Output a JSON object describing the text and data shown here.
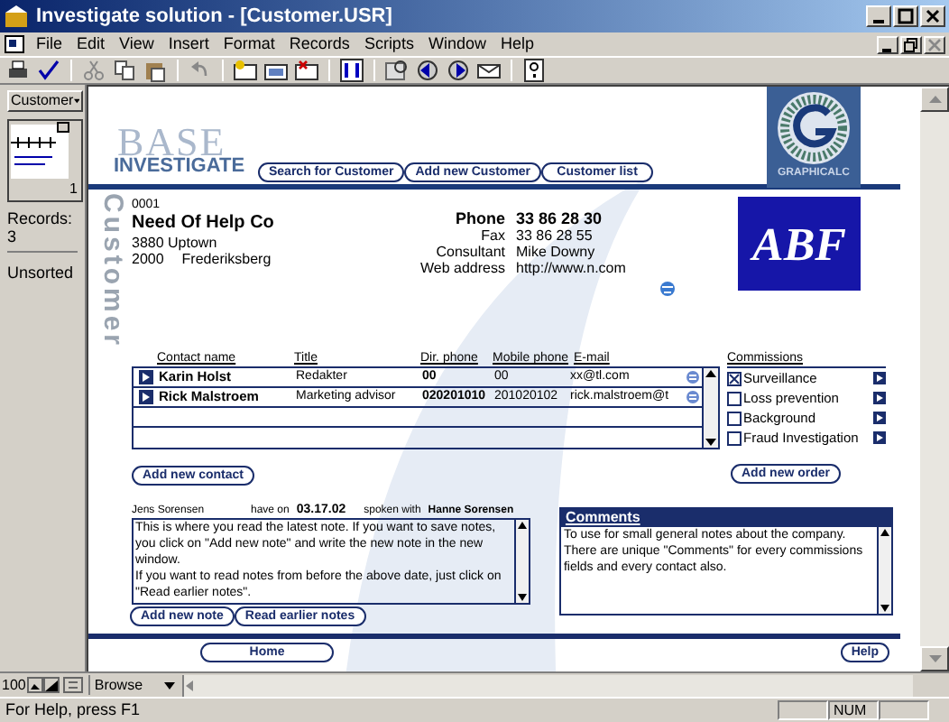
{
  "window": {
    "title": "Investigate solution - [Customer.USR]"
  },
  "menu": [
    "File",
    "Edit",
    "View",
    "Insert",
    "Format",
    "Records",
    "Scripts",
    "Window",
    "Help"
  ],
  "status_area": {
    "layout": "Customer",
    "record_number": "1",
    "records_label": "Records:",
    "records_count": "3",
    "sort_state": "Unsorted"
  },
  "header": {
    "logo_faded": "BASE",
    "logo": "INVESTIGATE",
    "nav_buttons": [
      "Search for Customer",
      "Add new Customer",
      "Customer list"
    ],
    "brand_caption": "GRAPHICALC"
  },
  "section_label": "Customer",
  "customer": {
    "number": "0001",
    "name": "Need Of Help Co",
    "address": "3880 Uptown",
    "postcode": "2000",
    "city": "Frederiksberg",
    "logo_text": "ABF",
    "fields": [
      {
        "label": "Phone",
        "value": "33 86 28 30",
        "bold": true
      },
      {
        "label": "Fax",
        "value": "33 86 28 55",
        "bold": false
      },
      {
        "label": "Consultant",
        "value": "Mike Downy",
        "bold": false
      },
      {
        "label": "Web address",
        "value": "http://www.n.com",
        "bold": false
      }
    ]
  },
  "contacts": {
    "columns": [
      "Contact name",
      "Title",
      "Dir. phone",
      "Mobile phone",
      "E-mail"
    ],
    "rows": [
      {
        "name": "Karin Holst",
        "title": "Redakter",
        "dir_phone": "00",
        "mobile_phone": "00",
        "email": "xx@tl.com"
      },
      {
        "name": "Rick Malstroem",
        "title": "Marketing advisor",
        "dir_phone": "020201010",
        "mobile_phone": "201020102",
        "email": "rick.malstroem@t"
      }
    ],
    "add_button": "Add new contact"
  },
  "commissions": {
    "title": "Commissions",
    "items": [
      {
        "label": "Surveillance",
        "checked": true
      },
      {
        "label": "Loss prevention",
        "checked": false
      },
      {
        "label": "Background",
        "checked": false
      },
      {
        "label": "Fraud Investigation",
        "checked": false
      }
    ],
    "add_button": "Add new order"
  },
  "notes": {
    "author": "Jens Sorensen",
    "have_on": "have on",
    "date": "03.17.02",
    "spoken_with": "spoken with",
    "contact": "Hanne Sorensen",
    "text": "This is where you read the latest note. If you want to save notes, you click on \"Add new note\" and write the new note in the new window.\nIf you want to read notes from before the above date, just click on \"Read earlier notes\".",
    "buttons": [
      "Add new note",
      "Read earlier notes"
    ]
  },
  "comments": {
    "title": "Comments",
    "text": "To use for small general notes about the company. There are unique \"Comments\" for every commissions fields and every contact also."
  },
  "footer_buttons": {
    "home": "Home",
    "help": "Help"
  },
  "bottom_bar": {
    "zoom": "100",
    "mode": "Browse"
  },
  "status_bar": {
    "text": "For Help, press F1",
    "indicator": "NUM"
  }
}
